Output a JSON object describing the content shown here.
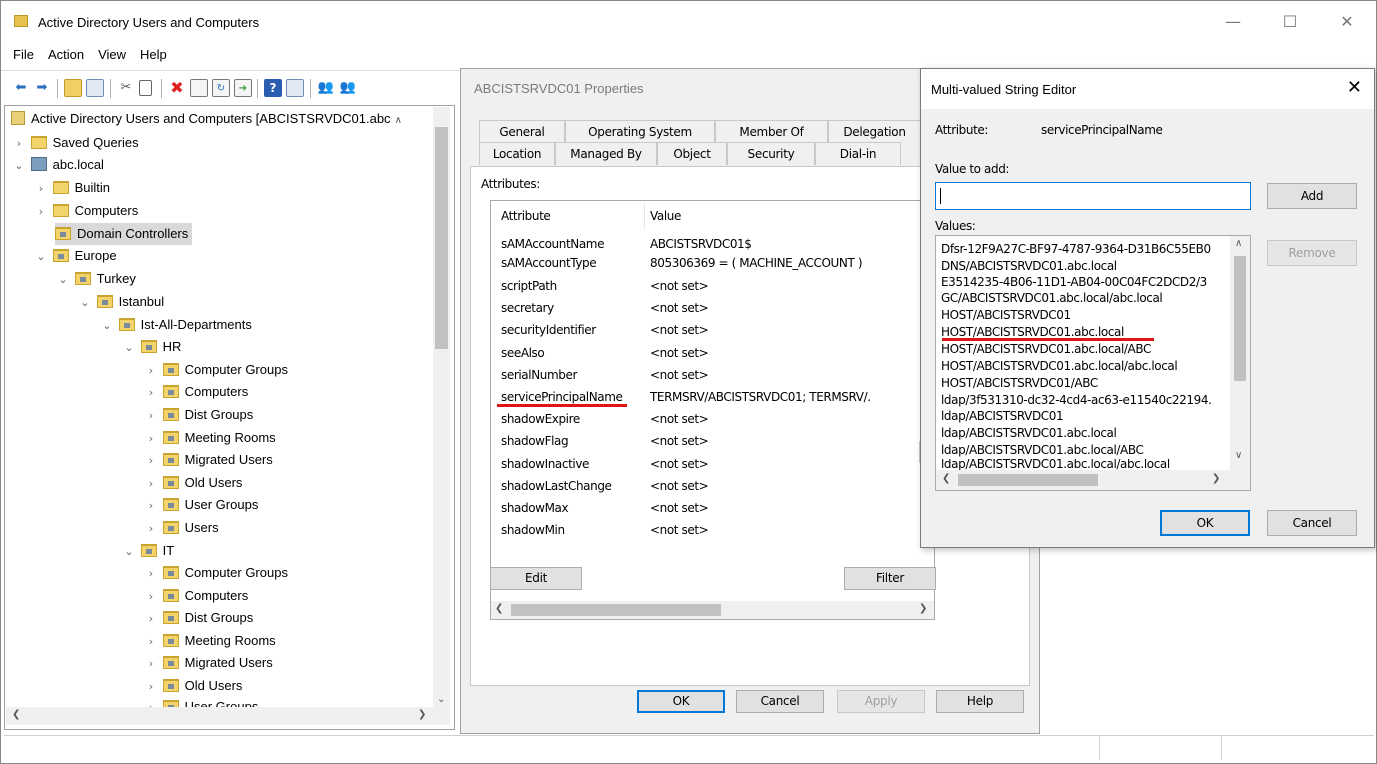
{
  "main_window": {
    "title": "Active Directory Users and Computers",
    "controls": {
      "minimize": "—",
      "maximize": "☐",
      "close": "✕"
    },
    "menu": [
      "File",
      "Action",
      "View",
      "Help"
    ]
  },
  "toolbar": {
    "icons": [
      "back-arrow-icon",
      "forward-arrow-icon",
      "up-folder-icon",
      "show-console-tree-icon",
      "cut-icon",
      "copy-icon",
      "delete-icon",
      "properties-icon",
      "refresh-icon",
      "export-list-icon",
      "help-icon",
      "console-icon",
      "users-icon",
      "add-group-icon"
    ]
  },
  "tree": {
    "root": "Active Directory Users and Computers [ABCISTSRVDC01.abc",
    "items": [
      {
        "label": "Saved Queries"
      },
      {
        "label": "abc.local"
      },
      {
        "label": "Builtin"
      },
      {
        "label": "Computers"
      },
      {
        "label": "Domain Controllers"
      },
      {
        "label": "Europe"
      },
      {
        "label": "Turkey"
      },
      {
        "label": "Istanbul"
      },
      {
        "label": "Ist-All-Departments"
      },
      {
        "label": "HR"
      },
      {
        "label": "Computer Groups"
      },
      {
        "label": "Computers"
      },
      {
        "label": "Dist Groups"
      },
      {
        "label": "Meeting Rooms"
      },
      {
        "label": "Migrated Users"
      },
      {
        "label": "Old Users"
      },
      {
        "label": "User Groups"
      },
      {
        "label": "Users"
      },
      {
        "label": "IT"
      },
      {
        "label": "Computer Groups"
      },
      {
        "label": "Computers"
      },
      {
        "label": "Dist Groups"
      },
      {
        "label": "Meeting Rooms"
      },
      {
        "label": "Migrated Users"
      },
      {
        "label": "Old Users"
      },
      {
        "label": "User Groups"
      }
    ],
    "selected": "Domain Controllers"
  },
  "properties": {
    "title": "ABCISTSRVDC01 Properties",
    "tabs_row1": [
      "General",
      "Operating System",
      "Member Of",
      "Delegation"
    ],
    "tabs_row2": [
      "Location",
      "Managed By",
      "Object",
      "Security",
      "Dial-in"
    ],
    "attributes_label": "Attributes:",
    "columns": {
      "attribute": "Attribute",
      "value": "Value"
    },
    "rows": [
      {
        "attr": "sAMAccountName",
        "value": "ABCISTSRVDC01$"
      },
      {
        "attr": "sAMAccountType",
        "value": "805306369 = ( MACHINE_ACCOUNT )"
      },
      {
        "attr": "scriptPath",
        "value": "<not set>"
      },
      {
        "attr": "secretary",
        "value": "<not set>"
      },
      {
        "attr": "securityIdentifier",
        "value": "<not set>"
      },
      {
        "attr": "seeAlso",
        "value": "<not set>"
      },
      {
        "attr": "serialNumber",
        "value": "<not set>"
      },
      {
        "attr": "servicePrincipalName",
        "value": "TERMSRV/ABCISTSRVDC01; TERMSRV/."
      },
      {
        "attr": "shadowExpire",
        "value": "<not set>"
      },
      {
        "attr": "shadowFlag",
        "value": "<not set>"
      },
      {
        "attr": "shadowInactive",
        "value": "<not set>"
      },
      {
        "attr": "shadowLastChange",
        "value": "<not set>"
      },
      {
        "attr": "shadowMax",
        "value": "<not set>"
      },
      {
        "attr": "shadowMin",
        "value": "<not set>"
      }
    ],
    "buttons": {
      "edit": "Edit",
      "filter": "Filter",
      "ok": "OK",
      "cancel": "Cancel",
      "apply": "Apply",
      "help": "Help"
    }
  },
  "editor": {
    "title": "Multi-valued String Editor",
    "attribute_label": "Attribute:",
    "attribute_value": "servicePrincipalName",
    "value_to_add_label": "Value to add:",
    "value_to_add": "",
    "values_label": "Values:",
    "values": [
      "Dfsr-12F9A27C-BF97-4787-9364-D31B6C55EB0",
      "DNS/ABCISTSRVDC01.abc.local",
      "E3514235-4B06-11D1-AB04-00C04FC2DCD2/3",
      "GC/ABCISTSRVDC01.abc.local/abc.local",
      "HOST/ABCISTSRVDC01",
      "HOST/ABCISTSRVDC01.abc.local",
      "HOST/ABCISTSRVDC01.abc.local/ABC",
      "HOST/ABCISTSRVDC01.abc.local/abc.local",
      "HOST/ABCISTSRVDC01/ABC",
      "ldap/3f531310-dc32-4cd4-ac63-e11540c22194.",
      "ldap/ABCISTSRVDC01",
      "ldap/ABCISTSRVDC01.abc.local",
      "ldap/ABCISTSRVDC01.abc.local/ABC",
      "ldap/ABCISTSRVDC01.abc.local/abc.local"
    ],
    "buttons": {
      "add": "Add",
      "remove": "Remove",
      "ok": "OK",
      "cancel": "Cancel"
    }
  },
  "colors": {
    "accent": "#0078d7",
    "highlight_underline": "#e01515",
    "selection": "#d9d9d9"
  }
}
